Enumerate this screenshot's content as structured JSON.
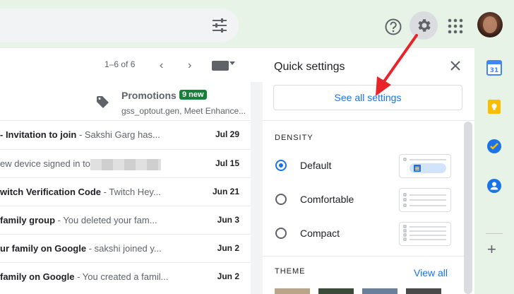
{
  "pagination": {
    "range": "1–6 of 6"
  },
  "promotions": {
    "title": "Promotions",
    "badge": "9 new",
    "subtitle": "gss_optout.gen, Meet Enhance..."
  },
  "emails": [
    {
      "subject": "- Invitation to join",
      "snippet": " - Sakshi Garg has...",
      "date": "Jul 29"
    },
    {
      "subject": "",
      "snippet": "ew device signed in to",
      "date": "Jul 15",
      "redacted": true
    },
    {
      "subject": "witch Verification Code",
      "snippet": " - Twitch Hey...",
      "date": "Jun 21"
    },
    {
      "subject": " family group",
      "snippet": " - You deleted your fam...",
      "date": "Jun 3"
    },
    {
      "subject": "ur family on Google",
      "snippet": " - sakshi joined y...",
      "date": "Jun 2"
    },
    {
      "subject": " family on Google",
      "snippet": " - You created a famil...",
      "date": "Jun 2"
    }
  ],
  "quick_settings": {
    "title": "Quick settings",
    "see_all": "See all settings",
    "density_label": "DENSITY",
    "density_options": [
      {
        "label": "Default",
        "selected": true
      },
      {
        "label": "Comfortable",
        "selected": false
      },
      {
        "label": "Compact",
        "selected": false
      }
    ],
    "theme_label": "THEME",
    "view_all": "View all"
  },
  "colors": {
    "accent": "#1a73e8",
    "badge_green": "#188038",
    "annotation_arrow": "#e8232a"
  }
}
